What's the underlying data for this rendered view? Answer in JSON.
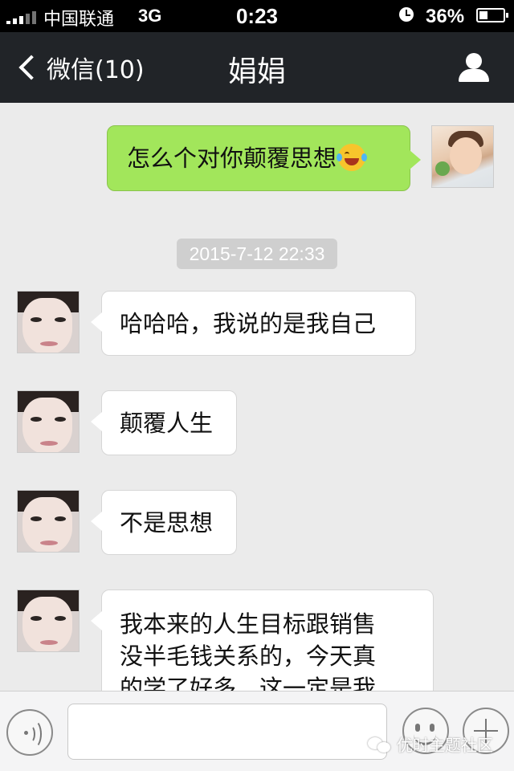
{
  "status_bar": {
    "carrier": "中国联通",
    "network": "3G",
    "time": "0:23",
    "battery": "36%",
    "battery_level": 0.36
  },
  "nav": {
    "back_label": "微信(10)",
    "title": "娟娟"
  },
  "messages": [
    {
      "direction": "out",
      "text": "怎么个对你颠覆思想"
    },
    {
      "type": "timestamp",
      "text": "2015-7-12 22:33"
    },
    {
      "direction": "in",
      "text": "哈哈哈，我说的是我自己"
    },
    {
      "direction": "in",
      "text": "颠覆人生"
    },
    {
      "direction": "in",
      "text": "不是思想"
    },
    {
      "direction": "in",
      "lines": [
        "我本来的人生目标跟销售",
        "没半毛钱关系的，今天真",
        "的学了好多，这一定是我"
      ]
    }
  ],
  "icons": {
    "emoji_in_message": "crying-laughing-emoji",
    "back": "chevron-left-icon",
    "profile": "person-icon",
    "voice": "voice-icon",
    "emoji": "smiley-icon",
    "plus": "plus-icon"
  },
  "watermark": "优时主题社区",
  "colors": {
    "nav_bg": "#212428",
    "outgoing_bubble": "#a2e65b",
    "incoming_bubble": "#ffffff",
    "chat_bg": "#ebebeb"
  }
}
